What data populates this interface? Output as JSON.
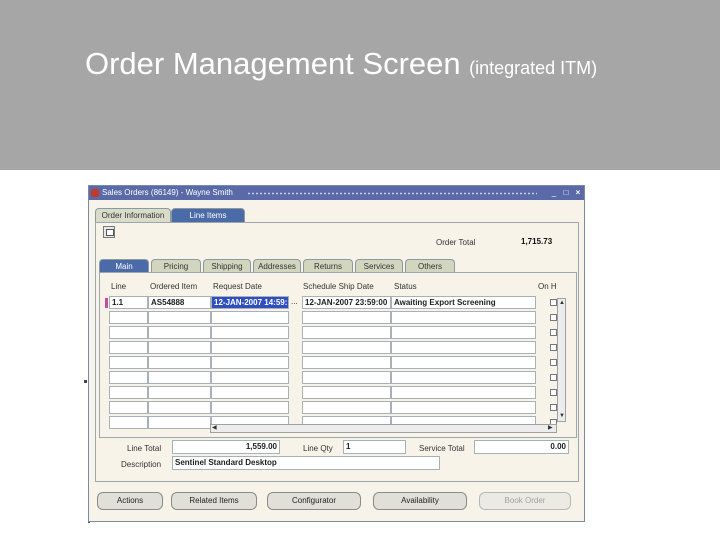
{
  "banner": {
    "title": "Order Management Screen",
    "subtitle": "(integrated ITM)"
  },
  "window": {
    "title": "Sales Orders (86149) - Wayne Smith",
    "controls": [
      "minimize-icon",
      "maximize-icon",
      "close-icon"
    ]
  },
  "top_tabs": [
    {
      "label": "Order Information",
      "active": false
    },
    {
      "label": "Line Items",
      "active": true
    }
  ],
  "order_total": {
    "label": "Order Total",
    "value": "1,715.73"
  },
  "line_tabs": [
    {
      "label": "Main",
      "active": true
    },
    {
      "label": "Pricing",
      "active": false
    },
    {
      "label": "Shipping",
      "active": false
    },
    {
      "label": "Addresses",
      "active": false
    },
    {
      "label": "Returns",
      "active": false
    },
    {
      "label": "Services",
      "active": false
    },
    {
      "label": "Others",
      "active": false
    }
  ],
  "grid": {
    "columns": [
      "Line",
      "Ordered Item",
      "Request Date",
      "Schedule Ship Date",
      "Status",
      "On H"
    ],
    "rows": [
      {
        "line": "1.1",
        "item": "AS54888",
        "request_date": "12-JAN-2007 14:59:",
        "ship_date": "12-JAN-2007 23:59:00",
        "status": "Awaiting Export Screening"
      },
      {
        "line": "",
        "item": "",
        "request_date": "",
        "ship_date": "",
        "status": ""
      },
      {
        "line": "",
        "item": "",
        "request_date": "",
        "ship_date": "",
        "status": ""
      },
      {
        "line": "",
        "item": "",
        "request_date": "",
        "ship_date": "",
        "status": ""
      },
      {
        "line": "",
        "item": "",
        "request_date": "",
        "ship_date": "",
        "status": ""
      },
      {
        "line": "",
        "item": "",
        "request_date": "",
        "ship_date": "",
        "status": ""
      },
      {
        "line": "",
        "item": "",
        "request_date": "",
        "ship_date": "",
        "status": ""
      },
      {
        "line": "",
        "item": "",
        "request_date": "",
        "ship_date": "",
        "status": ""
      },
      {
        "line": "",
        "item": "",
        "request_date": "",
        "ship_date": "",
        "status": ""
      }
    ],
    "lov_glyph": "..."
  },
  "summary": {
    "line_total_label": "Line Total",
    "line_total_value": "1,559.00",
    "line_qty_label": "Line Qty",
    "line_qty_value": "1",
    "service_total_label": "Service Total",
    "service_total_value": "0.00",
    "description_label": "Description",
    "description_value": "Sentinel Standard Desktop"
  },
  "buttons": [
    {
      "label": "Actions",
      "enabled": true
    },
    {
      "label": "Related Items",
      "enabled": true
    },
    {
      "label": "Configurator",
      "enabled": true
    },
    {
      "label": "Availability",
      "enabled": true
    },
    {
      "label": "Book Order",
      "enabled": false
    }
  ],
  "colors": {
    "banner_bg": "#a6a6a6",
    "title_bar": "#5a6aa8",
    "active_tab": "#4a6aa8",
    "selected_cell": "#2f4fc0",
    "form_bg": "#f7f3e8"
  }
}
